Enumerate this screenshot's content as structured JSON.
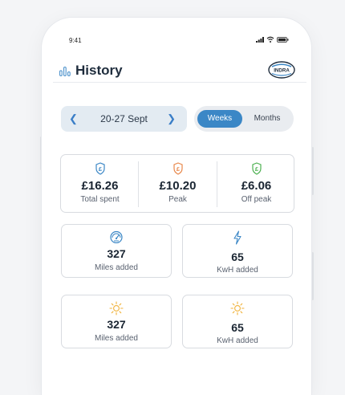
{
  "status_bar": {
    "time": "9:41"
  },
  "header": {
    "title": "History",
    "logo_text": "INDRA"
  },
  "date_range": {
    "label": "20-27 Sept"
  },
  "period_toggle": {
    "options": [
      "Weeks",
      "Months"
    ],
    "selected": "Weeks"
  },
  "costs": [
    {
      "amount": "£16.26",
      "label": "Total spent",
      "color": "#3b87c6"
    },
    {
      "amount": "£10.20",
      "label": "Peak",
      "color": "#e8874a"
    },
    {
      "amount": "£6.06",
      "label": "Off peak",
      "color": "#4cb050"
    }
  ],
  "metrics": [
    {
      "value": "327",
      "label": "Miles added",
      "icon": "speedometer-icon",
      "color": "#3b87c6"
    },
    {
      "value": "65",
      "label": "KwH added",
      "icon": "lightning-icon",
      "color": "#3b87c6"
    },
    {
      "value": "327",
      "label": "Miles added",
      "icon": "sun-icon",
      "color": "#f0b23a"
    },
    {
      "value": "65",
      "label": "KwH added",
      "icon": "sun-icon",
      "color": "#f0b23a"
    }
  ]
}
